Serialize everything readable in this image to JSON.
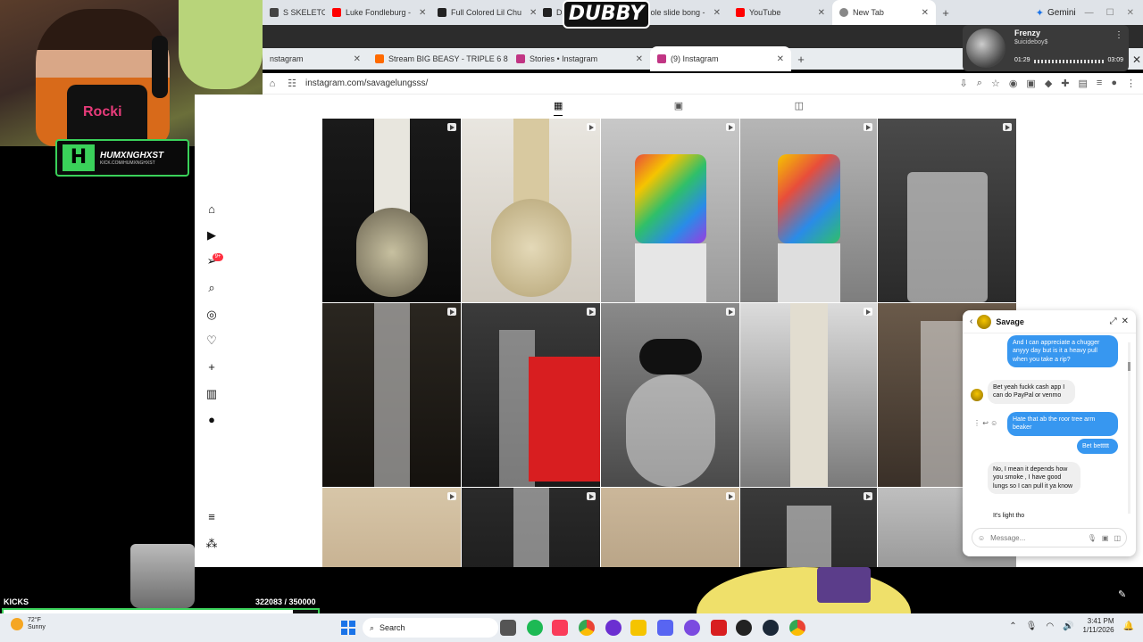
{
  "browser_top": {
    "tabs": [
      {
        "label": "S SKELETO",
        "color": "#444"
      },
      {
        "label": "Luke Fondleburg -",
        "color": "#ff0000"
      },
      {
        "label": "Full Colored Lil Chu",
        "color": "#222"
      },
      {
        "label": "Daily",
        "color": "#222"
      },
      {
        "label": "4 hole slide bong -",
        "color": "#ff0000"
      },
      {
        "label": "YouTube",
        "color": "#ff0000"
      },
      {
        "label": "New Tab",
        "color": "#666"
      }
    ],
    "gemini_label": "Gemini"
  },
  "dubby_logo": "DUBBY",
  "browser_second": {
    "tabs": [
      {
        "label": "nstagram",
        "color": "#c13584"
      },
      {
        "label": "Stream BIG BEASY - TRIPLE 6 8",
        "color": "#ff6a00"
      },
      {
        "label": "Stories • Instagram",
        "color": "#c13584"
      },
      {
        "label": "(9) Instagram",
        "color": "#c13584"
      }
    ],
    "url": "instagram.com/savagelungsss/"
  },
  "music_player": {
    "song": "Frenzy",
    "artist": "$uicideboy$",
    "elapsed": "01:29",
    "duration": "03:09"
  },
  "nav": {
    "notification_count": "9+"
  },
  "chat": {
    "name": "Savage",
    "messages": [
      {
        "dir": "out",
        "text": "And I can appreciate a chugger anyyy day but is it a heavy pull when you take a rip?"
      },
      {
        "dir": "in",
        "text": "Bet yeah fuckk cash app I can do PayPal or venmo"
      },
      {
        "dir": "out",
        "text": "Hate that ab the roor tree arm beaker"
      },
      {
        "dir": "out",
        "text": "Bet bettttt"
      },
      {
        "dir": "in",
        "text": "No, I mean it depends how you smoke , I have good lungs so I can pull it ya know"
      },
      {
        "dir": "in",
        "text": "It's light tho"
      }
    ],
    "placeholder": "Message..."
  },
  "stream": {
    "shirt_text": "Rocki",
    "logo_name": "HUMXNGHXST",
    "logo_url": "KICK.COM/HUMXNGHXST",
    "kicks_label": "KICKS",
    "kicks_count": "322083  / 350000",
    "kicks_progress": 0.92
  },
  "taskbar": {
    "temp": "72°F",
    "condition": "Sunny",
    "search_label": "Search",
    "time": "3:41 PM",
    "date": "1/11/2026"
  }
}
